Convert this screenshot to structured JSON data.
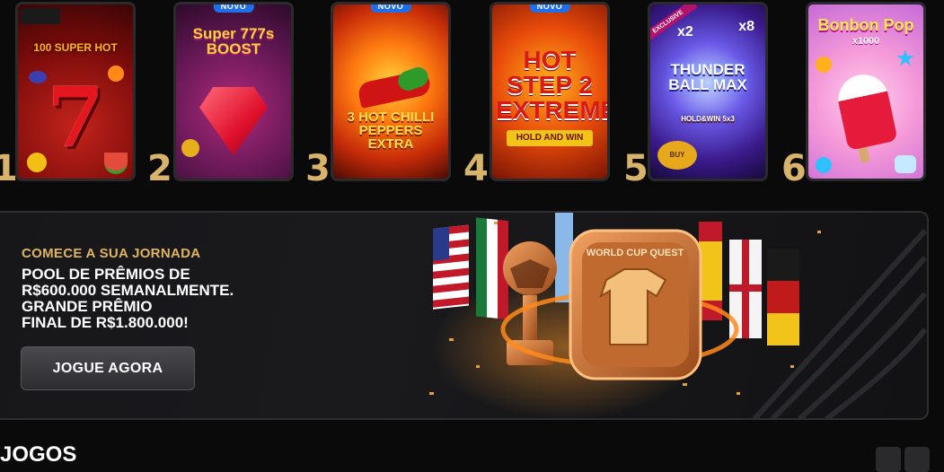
{
  "top_games": [
    {
      "rank": "1",
      "title": "100 SUPER HOT",
      "badge": "",
      "art_label": "7"
    },
    {
      "rank": "2",
      "title": "Super 777s BOOST",
      "badge": "NOVO",
      "art_label": ""
    },
    {
      "rank": "3",
      "title": "3 HOT CHILLI PEPPERS EXTRA",
      "badge": "NOVO",
      "art_label": ""
    },
    {
      "rank": "4",
      "title": "HOT STEP 2 EXTREME",
      "badge": "NOVO",
      "art_label": "HOLD AND WIN"
    },
    {
      "rank": "5",
      "title": "THUNDER BALL MAX",
      "badge": "",
      "art_label": "HOLD&WIN 5x3",
      "ribbon": "EXCLUSIVE",
      "multipliers": [
        "x2",
        "x8"
      ],
      "bonus_label": "BUY BONUS"
    },
    {
      "rank": "6",
      "title": "Bonbon Pop",
      "badge": "",
      "art_label": "x1000"
    }
  ],
  "promo": {
    "kicker": "COMECE A SUA JORNADA",
    "headline_lines": [
      "POOL DE PRÊMIOS DE",
      "R$600.000 SEMANALMENTE.",
      "GRANDE PRÊMIO",
      "FINAL DE R$1.800.000!"
    ],
    "cta_label": "JOGUE AGORA",
    "badge_title": "WORLD CUP QUEST"
  },
  "section": {
    "title": "JOGOS"
  },
  "colors": {
    "rank_gold": "#d8b46b",
    "kicker_gold": "#e0b45e",
    "badge_blue": "#1e6fe8"
  }
}
